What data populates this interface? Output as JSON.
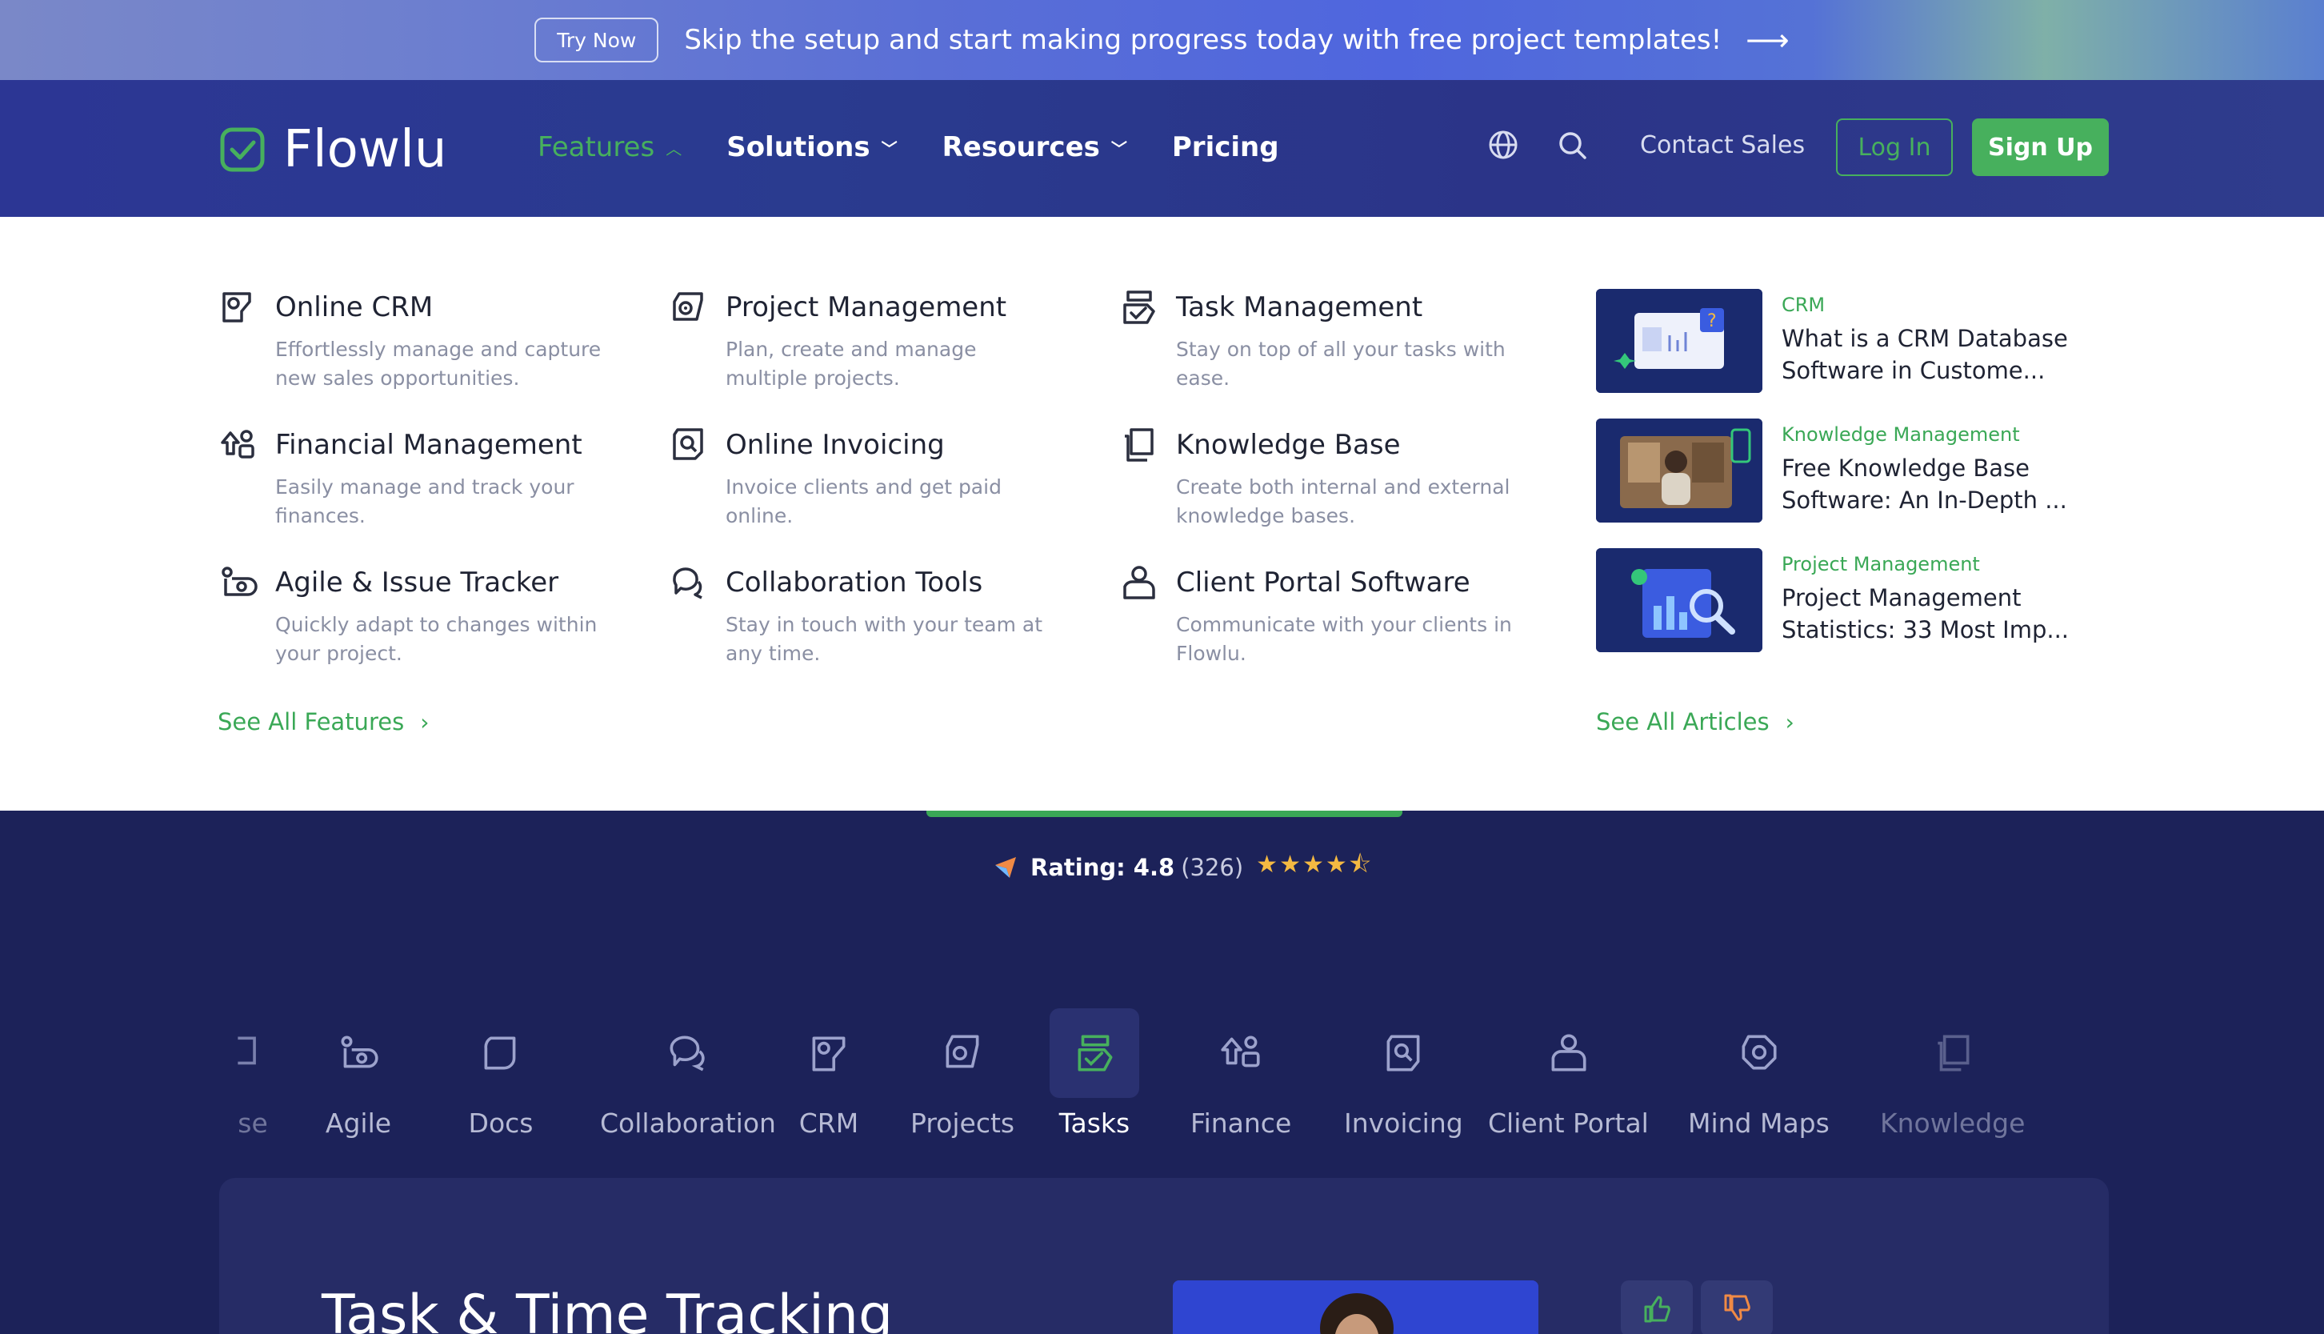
{
  "banner": {
    "try_now": "Try Now",
    "text": "Skip the setup and start making progress today with free project templates!"
  },
  "header": {
    "logo": "Flowlu",
    "nav": [
      {
        "label": "Features"
      },
      {
        "label": "Solutions"
      },
      {
        "label": "Resources"
      },
      {
        "label": "Pricing"
      }
    ],
    "contact": "Contact Sales",
    "login": "Log In",
    "signup": "Sign Up"
  },
  "menu": {
    "features": [
      {
        "title": "Online CRM",
        "desc": "Effortlessly manage and capture new sales opportunities.",
        "icon": "crm-icon"
      },
      {
        "title": "Project Management",
        "desc": "Plan, create and manage multiple projects.",
        "icon": "project-icon"
      },
      {
        "title": "Task Management",
        "desc": "Stay on top of all your tasks with ease.",
        "icon": "task-icon"
      },
      {
        "title": "Financial Management",
        "desc": "Easily manage and track your finances.",
        "icon": "finance-icon"
      },
      {
        "title": "Online Invoicing",
        "desc": "Invoice clients and get paid online.",
        "icon": "invoice-icon"
      },
      {
        "title": "Knowledge Base",
        "desc": "Create both internal and external knowledge bases.",
        "icon": "knowledge-icon"
      },
      {
        "title": "Agile & Issue Tracker",
        "desc": "Quickly adapt to changes within your project.",
        "icon": "agile-icon"
      },
      {
        "title": "Collaboration Tools",
        "desc": "Stay in touch with your team at any time.",
        "icon": "collab-icon"
      },
      {
        "title": "Client Portal Software",
        "desc": "Communicate with your clients in Flowlu.",
        "icon": "client-portal-icon"
      }
    ],
    "see_all_features": "See All Features",
    "articles": [
      {
        "category": "CRM",
        "title": "What is a CRM Database Software in Custome..."
      },
      {
        "category": "Knowledge Management",
        "title": "Free Knowledge Base Software: An In-Depth ..."
      },
      {
        "category": "Project Management",
        "title": "Project Management Statistics: 33 Most Imp..."
      }
    ],
    "see_all_articles": "See All Articles"
  },
  "rating": {
    "label": "Rating: 4.8",
    "count": "(326)",
    "stars": 4.5
  },
  "tabs": [
    {
      "label": "se",
      "icon": "partial-icon"
    },
    {
      "label": "Agile",
      "icon": "agile-icon"
    },
    {
      "label": "Docs",
      "icon": "docs-icon"
    },
    {
      "label": "Collaboration",
      "icon": "collab-icon"
    },
    {
      "label": "CRM",
      "icon": "crm-icon"
    },
    {
      "label": "Projects",
      "icon": "project-icon"
    },
    {
      "label": "Tasks",
      "icon": "task-icon"
    },
    {
      "label": "Finance",
      "icon": "finance-icon"
    },
    {
      "label": "Invoicing",
      "icon": "invoice-icon"
    },
    {
      "label": "Client Portal",
      "icon": "client-portal-icon"
    },
    {
      "label": "Mind Maps",
      "icon": "mindmap-icon"
    },
    {
      "label": "Knowledge",
      "icon": "knowledge-icon"
    }
  ],
  "active_tab": "Tasks",
  "panel": {
    "title": "Task & Time Tracking"
  },
  "colors": {
    "accent": "#47b05d",
    "navy": "#1c2259",
    "header": "#2c3694"
  }
}
